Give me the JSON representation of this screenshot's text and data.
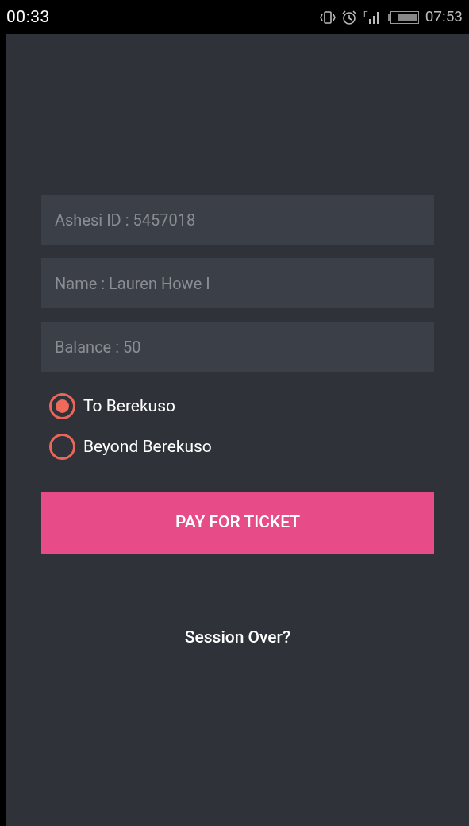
{
  "status_bar": {
    "left_time": "00:33",
    "network_type": "E",
    "time": "07:53"
  },
  "fields": [
    {
      "placeholder": "Ashesi ID : 5457018"
    },
    {
      "placeholder": "Name : Lauren Howe I"
    },
    {
      "placeholder": "Balance : 50"
    }
  ],
  "destinations": [
    {
      "label": "To Berekuso",
      "selected": true
    },
    {
      "label": "Beyond Berekuso",
      "selected": false
    }
  ],
  "pay_button": "PAY FOR TICKET",
  "session_link": "Session Over?"
}
